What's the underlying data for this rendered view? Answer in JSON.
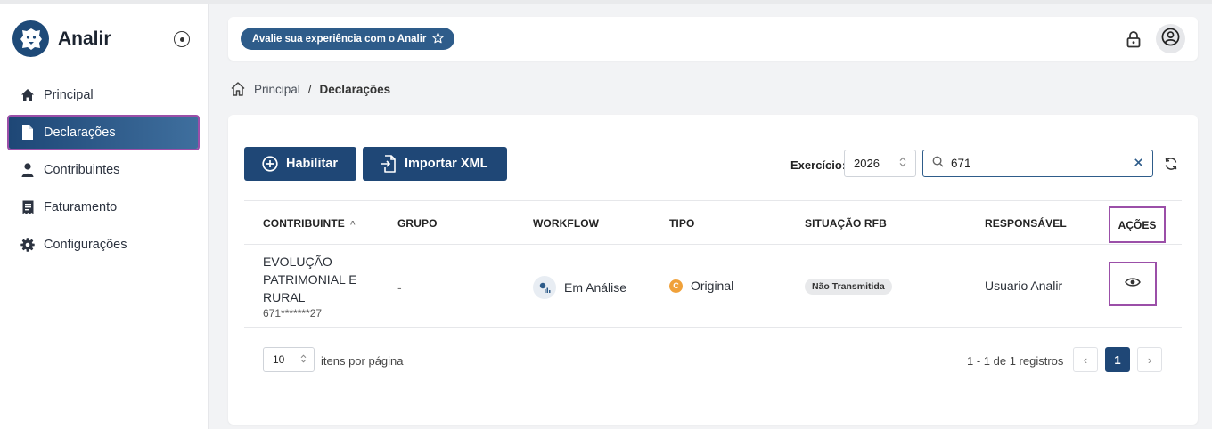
{
  "app": {
    "name": "Analir"
  },
  "sidebar": {
    "items": [
      {
        "label": "Principal",
        "icon": "home-icon"
      },
      {
        "label": "Declarações",
        "icon": "file-icon",
        "active": true
      },
      {
        "label": "Contribuintes",
        "icon": "user-icon"
      },
      {
        "label": "Faturamento",
        "icon": "receipt-icon"
      },
      {
        "label": "Configurações",
        "icon": "gear-icon"
      }
    ]
  },
  "header": {
    "feedback_label": "Avalie sua experiência com o Analir"
  },
  "breadcrumb": {
    "home": "Principal",
    "separator": "/",
    "current": "Declarações"
  },
  "toolbar": {
    "habilitar_label": "Habilitar",
    "importar_label": "Importar XML",
    "exercicio_label": "Exercício:",
    "exercicio_value": "2026",
    "search_value": "671"
  },
  "table": {
    "columns": [
      "CONTRIBUINTE",
      "GRUPO",
      "WORKFLOW",
      "TIPO",
      "SITUAÇÃO RFB",
      "RESPONSÁVEL",
      "AÇÕES"
    ],
    "rows": [
      {
        "contribuinte": "EVOLUÇÃO PATRIMONIAL E RURAL",
        "cpf": "671*******27",
        "grupo": "-",
        "workflow": "Em Análise",
        "tipo": "Original",
        "tipo_badge": "C",
        "situacao": "Não Transmitida",
        "responsavel": "Usuario Analir"
      }
    ]
  },
  "pagination": {
    "per_page": "10",
    "per_page_label": "itens por página",
    "range": "1 - 1 de 1 registros",
    "current_page": "1",
    "prev": "‹",
    "next": "›"
  },
  "colors": {
    "primary": "#1f4776",
    "highlight": "#9b4fa8",
    "badge_orange": "#f0a13a"
  }
}
